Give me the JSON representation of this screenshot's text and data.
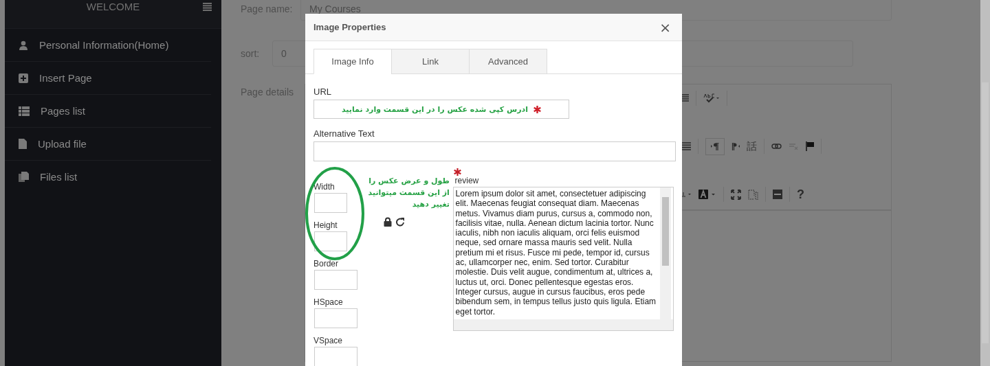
{
  "sidebar": {
    "title": "WELCOME",
    "items": [
      {
        "label": "Personal Information(Home)",
        "kind": "user"
      },
      {
        "label": "Insert Page",
        "kind": "plus"
      },
      {
        "label": "Pages list",
        "kind": "list"
      },
      {
        "label": "Upload file",
        "kind": "file"
      },
      {
        "label": "Files list",
        "kind": "files"
      }
    ]
  },
  "page": {
    "fields": [
      {
        "label": "Page name:",
        "value": "My Courses"
      },
      {
        "label": "sort:",
        "value": "0"
      }
    ],
    "details_label": "Page details",
    "editor": {
      "language_glyph": "話",
      "help_glyph": "?",
      "ltr_selected": true
    }
  },
  "dialog": {
    "title": "Image Properties",
    "close": "×",
    "tabs": [
      {
        "label": "Image Info",
        "selected": true
      },
      {
        "label": "Link",
        "selected": false
      },
      {
        "label": "Advanced",
        "selected": false
      }
    ],
    "url": {
      "label": "URL",
      "note": "ادرس کپی شده عکس را در این قسمت وارد نمایید"
    },
    "alt_text": {
      "label": "Alternative Text"
    },
    "size_fields": [
      {
        "label": "Width"
      },
      {
        "label": "Height"
      },
      {
        "label": "Border"
      },
      {
        "label": "HSpace"
      },
      {
        "label": "VSpace"
      }
    ],
    "size_note": "طول و عرض عکس را از این قسمت میتوانید تغییر دهید",
    "preview": {
      "label": "review",
      "text": "Lorem ipsum dolor sit amet, consectetuer adipiscing elit. Maecenas feugiat consequat diam. Maecenas metus. Vivamus diam purus, cursus a, commodo non, facilisis vitae, nulla. Aenean dictum lacinia tortor. Nunc iaculis, nibh non iaculis aliquam, orci felis euismod neque, sed ornare massa mauris sed velit. Nulla pretium mi et risus. Fusce mi pede, tempor id, cursus ac, ullamcorper nec, enim. Sed tortor. Curabitur molestie. Duis velit augue, condimentum at, ultrices a, luctus ut, orci. Donec pellentesque egestas eros. Integer cursus, augue in cursus faucibus, eros pede bibendum sem, in tempus tellus justo quis ligula. Etiam eget tortor."
    }
  }
}
